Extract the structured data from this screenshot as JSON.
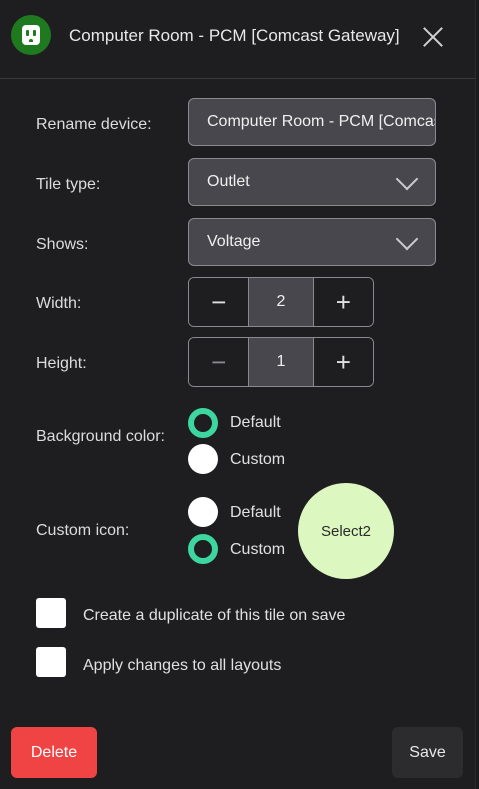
{
  "header": {
    "title": "Computer Room - PCM [Comcast Gateway]",
    "icon": "outlet-icon",
    "icon_bg": "#1f7a1f"
  },
  "form": {
    "rename_label": "Rename device:",
    "rename_value": "Computer Room - PCM [Comcast Gateway]",
    "tile_type_label": "Tile type:",
    "tile_type_value": "Outlet",
    "shows_label": "Shows:",
    "shows_value": "Voltage",
    "width_label": "Width:",
    "width_value": "2",
    "height_label": "Height:",
    "height_value": "1",
    "stepper_minus": "−",
    "stepper_plus": "+",
    "bg_color_label": "Background color:",
    "bg_color_options": [
      "Default",
      "Custom"
    ],
    "bg_color_selected": "Default",
    "custom_icon_label": "Custom icon:",
    "custom_icon_options": [
      "Default",
      "Custom"
    ],
    "custom_icon_selected": "Custom",
    "select_button": "Select2",
    "duplicate_label": "Create a duplicate of this tile on save",
    "apply_all_label": "Apply changes to all layouts"
  },
  "footer": {
    "delete_label": "Delete",
    "save_label": "Save"
  },
  "colors": {
    "accent": "#3ed6a0",
    "delete": "#f04444",
    "select_bubble": "#dcf7c0"
  }
}
